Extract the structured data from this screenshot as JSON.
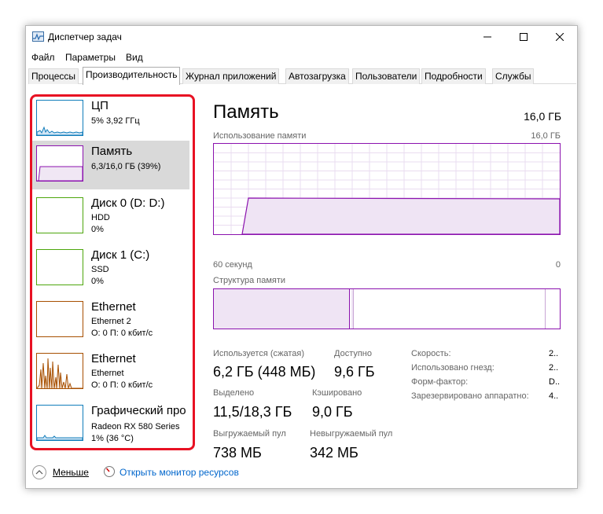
{
  "window": {
    "title": "Диспетчер задач",
    "icons": {
      "app": "task-manager-icon",
      "minimize": "minimize-icon",
      "maximize": "maximize-icon",
      "close": "close-icon"
    }
  },
  "menu": [
    "Файл",
    "Параметры",
    "Вид"
  ],
  "tabs": [
    "Процессы",
    "Производительность",
    "Журнал приложений",
    "Автозагрузка",
    "Пользователи",
    "Подробности",
    "Службы"
  ],
  "sidebar": {
    "items": [
      {
        "name": "ЦП",
        "line1": "5% 3,92 ГГц",
        "line2": "",
        "color": "#117dbb",
        "selected": false
      },
      {
        "name": "Память",
        "line1": "6,3/16,0 ГБ (39%)",
        "line2": "",
        "color": "#8b12ae",
        "selected": true
      },
      {
        "name": "Диск 0 (D: D:)",
        "line1": "HDD",
        "line2": "0%",
        "color": "#4da60c",
        "selected": false
      },
      {
        "name": "Диск 1 (C:)",
        "line1": "SSD",
        "line2": "0%",
        "color": "#4da60c",
        "selected": false
      },
      {
        "name": "Ethernet",
        "line1": "Ethernet 2",
        "line2": "О: 0 П: 0 кбит/с",
        "color": "#a74f01",
        "selected": false
      },
      {
        "name": "Ethernet",
        "line1": "Ethernet",
        "line2": "О: 0 П: 0 кбит/с",
        "color": "#a74f01",
        "selected": false
      },
      {
        "name": "Графический про",
        "line1": "Radeon RX 580 Series",
        "line2": "1% (36 °C)",
        "color": "#117dbb",
        "selected": false
      }
    ]
  },
  "detail": {
    "title": "Память",
    "total": "16,0 ГБ",
    "usage_label": "Использование памяти",
    "usage_max": "16,0 ГБ",
    "time_left": "60 секунд",
    "time_right": "0",
    "structure_label": "Структура памяти",
    "stats": {
      "used_label": "Используется (сжатая)",
      "used_value": "6,2 ГБ (448 МБ)",
      "avail_label": "Доступно",
      "avail_value": "9,6 ГБ",
      "committed_label": "Выделено",
      "committed_value": "11,5/18,3 ГБ",
      "cached_label": "Кэшировано",
      "cached_value": "9,0 ГБ",
      "paged_label": "Выгружаемый пул",
      "paged_value": "738 МБ",
      "nonpaged_label": "Невыгружаемый пул",
      "nonpaged_value": "342 МБ"
    },
    "properties": [
      {
        "label": "Скорость:",
        "value": "2.."
      },
      {
        "label": "Использовано гнезд:",
        "value": "2.."
      },
      {
        "label": "Форм-фактор:",
        "value": "D.."
      },
      {
        "label": "Зарезервировано аппаратно:",
        "value": "4.."
      }
    ]
  },
  "footer": {
    "less": "Меньше",
    "monitor": "Открыть монитор ресурсов"
  }
}
